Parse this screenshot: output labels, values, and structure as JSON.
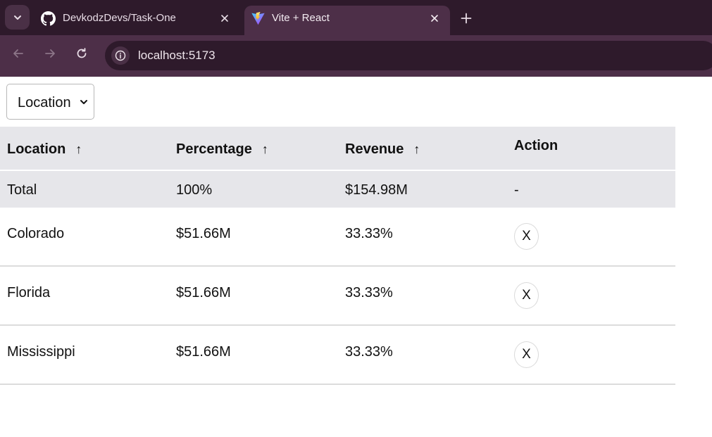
{
  "browser": {
    "tabs": [
      {
        "title": "DevkodzDevs/Task-One",
        "favicon": "github-icon",
        "active": false
      },
      {
        "title": "Vite + React",
        "favicon": "vite-icon",
        "active": true
      }
    ],
    "url": "localhost:5173"
  },
  "filter": {
    "selected": "Location"
  },
  "table": {
    "headers": [
      {
        "label": "Location",
        "sort": "↑"
      },
      {
        "label": "Percentage",
        "sort": "↑"
      },
      {
        "label": "Revenue",
        "sort": "↑"
      },
      {
        "label": "Action",
        "sort": ""
      }
    ],
    "total": {
      "location": "Total",
      "percentage": "100%",
      "revenue": "$154.98M",
      "action": "-"
    },
    "rows": [
      {
        "location": "Colorado",
        "percentage": "$51.66M",
        "revenue": "33.33%",
        "action": "X"
      },
      {
        "location": "Florida",
        "percentage": "$51.66M",
        "revenue": "33.33%",
        "action": "X"
      },
      {
        "location": "Mississippi",
        "percentage": "$51.66M",
        "revenue": "33.33%",
        "action": "X"
      }
    ]
  },
  "colors": {
    "chrome_dark": "#2e1a2b",
    "chrome_toolbar": "#4d2f48",
    "table_header_bg": "#e6e6ea"
  }
}
